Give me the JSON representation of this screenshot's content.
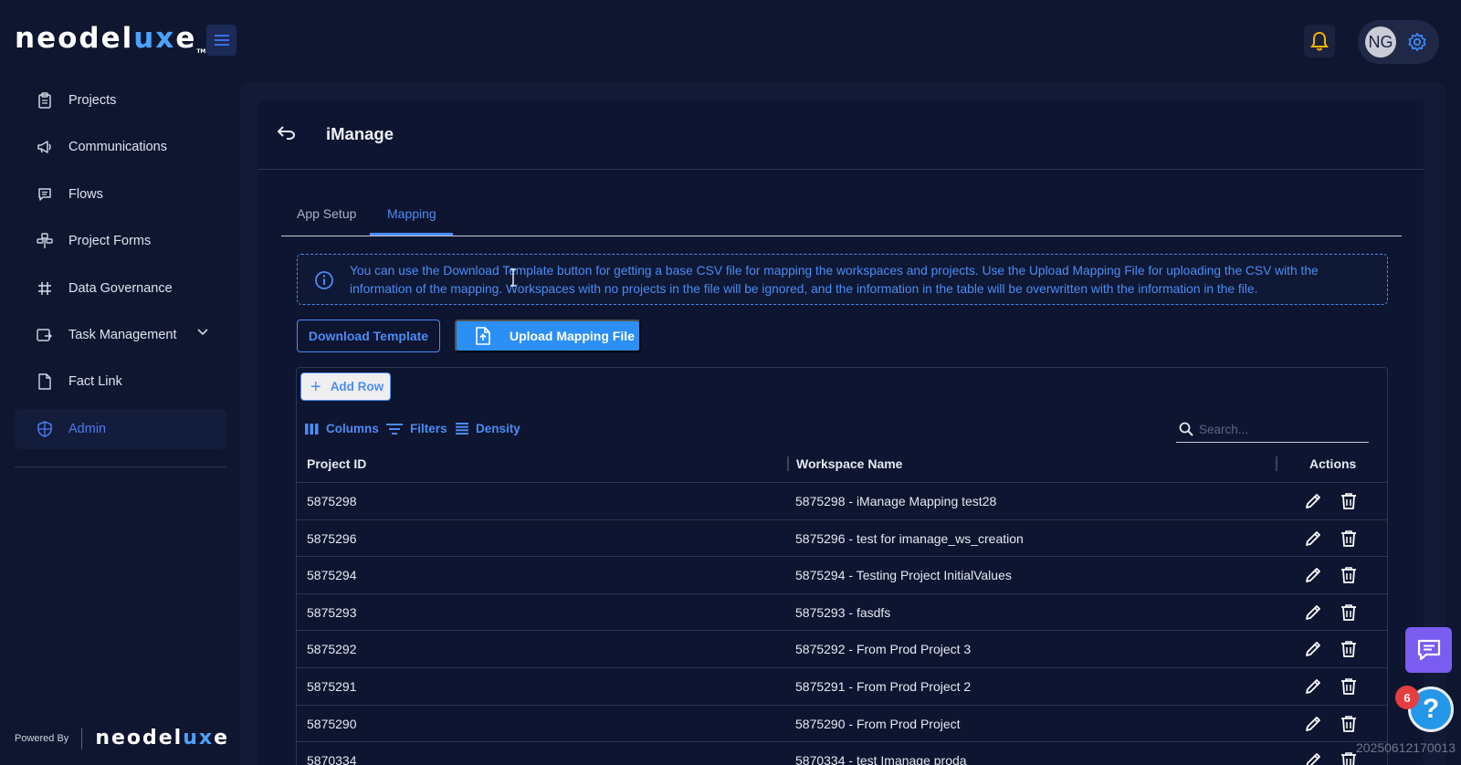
{
  "brand": {
    "name_prefix": "neodel",
    "name_accent": "ux",
    "name_suffix": "e",
    "tm": "TM",
    "accent_color": "#4aa3ff"
  },
  "header": {
    "user_initials": "NG",
    "bell_icon": "bell-icon",
    "settings_icon": "gear-icon"
  },
  "sidebar": {
    "items": [
      {
        "label": "Projects",
        "icon": "clipboard-icon"
      },
      {
        "label": "Communications",
        "icon": "megaphone-icon"
      },
      {
        "label": "Flows",
        "icon": "chat-icon"
      },
      {
        "label": "Project Forms",
        "icon": "forms-icon"
      },
      {
        "label": "Data Governance",
        "icon": "grid-hash-icon"
      },
      {
        "label": "Task Management",
        "icon": "task-icon"
      },
      {
        "label": "Fact Link",
        "icon": "document-icon"
      },
      {
        "label": "Admin",
        "icon": "shield-icon",
        "active": true
      }
    ],
    "powered_by": "Powered By"
  },
  "page": {
    "title": "iManage",
    "tabs": [
      {
        "label": "App Setup"
      },
      {
        "label": "Mapping",
        "active": true
      }
    ],
    "info_text": "You can use the Download Template button for getting a base CSV file for mapping the workspaces and projects. Use the Upload Mapping File for uploading the CSV with the information of the mapping. Workspaces with no projects in the file will be ignored, and the information in the table will be overwritten with the information in the file.",
    "download_label": "Download Template",
    "upload_label": "Upload Mapping File"
  },
  "grid": {
    "add_row_label": "Add Row",
    "toolbar": {
      "columns": "Columns",
      "filters": "Filters",
      "density": "Density"
    },
    "search_placeholder": "Search...",
    "columns": [
      "Project ID",
      "Workspace Name",
      "Actions"
    ],
    "rows": [
      {
        "project_id": "5875298",
        "workspace": "5875298 - iManage Mapping test28"
      },
      {
        "project_id": "5875296",
        "workspace": "5875296 - test for imanage_ws_creation"
      },
      {
        "project_id": "5875294",
        "workspace": "5875294 - Testing Project InitialValues"
      },
      {
        "project_id": "5875293",
        "workspace": "5875293 - fasdfs"
      },
      {
        "project_id": "5875292",
        "workspace": "5875292 - From Prod Project 3"
      },
      {
        "project_id": "5875291",
        "workspace": "5875291 - From Prod Project 2"
      },
      {
        "project_id": "5875290",
        "workspace": "5875290 - From Prod Project"
      },
      {
        "project_id": "5870334",
        "workspace": "5870334 - test Imanage proda"
      }
    ]
  },
  "floating": {
    "help_badge": "6",
    "help_symbol": "?"
  },
  "footer_stamp": "20250612170013"
}
